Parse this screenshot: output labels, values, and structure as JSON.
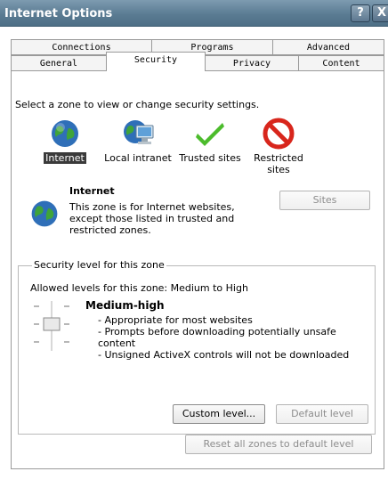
{
  "window": {
    "title": "Internet Options",
    "help_label": "?",
    "close_label": "X"
  },
  "tabs": {
    "row1": [
      {
        "label": "Connections"
      },
      {
        "label": "Programs"
      },
      {
        "label": "Advanced"
      }
    ],
    "row2": [
      {
        "label": "General"
      },
      {
        "label": "Security",
        "active": true
      },
      {
        "label": "Privacy"
      },
      {
        "label": "Content"
      }
    ]
  },
  "security": {
    "intro": "Select a zone to view or change security settings.",
    "zones": [
      {
        "label": "Internet",
        "icon": "globe-icon",
        "selected": true
      },
      {
        "label": "Local intranet",
        "icon": "intranet-icon"
      },
      {
        "label": "Trusted sites",
        "icon": "checkmark-icon"
      },
      {
        "label": "Restricted sites",
        "icon": "restricted-icon"
      }
    ],
    "selected_zone": {
      "title": "Internet",
      "description": "This zone is for Internet websites, except those listed in trusted and restricted zones."
    },
    "sites_button": "Sites",
    "level_group": {
      "legend": "Security level for this zone",
      "allowed": "Allowed levels for this zone: Medium to High",
      "level_name": "Medium-high",
      "bullets": [
        "- Appropriate for most websites",
        "- Prompts before downloading potentially unsafe content",
        "- Unsigned ActiveX controls will not be downloaded"
      ],
      "custom_button": "Custom level...",
      "default_button": "Default level"
    },
    "reset_button": "Reset all zones to default level"
  },
  "colors": {
    "titlebar": "#5b7c93",
    "selection": "#3a3a3a",
    "restricted_red": "#d8261c",
    "trusted_green": "#4cbc2c"
  }
}
